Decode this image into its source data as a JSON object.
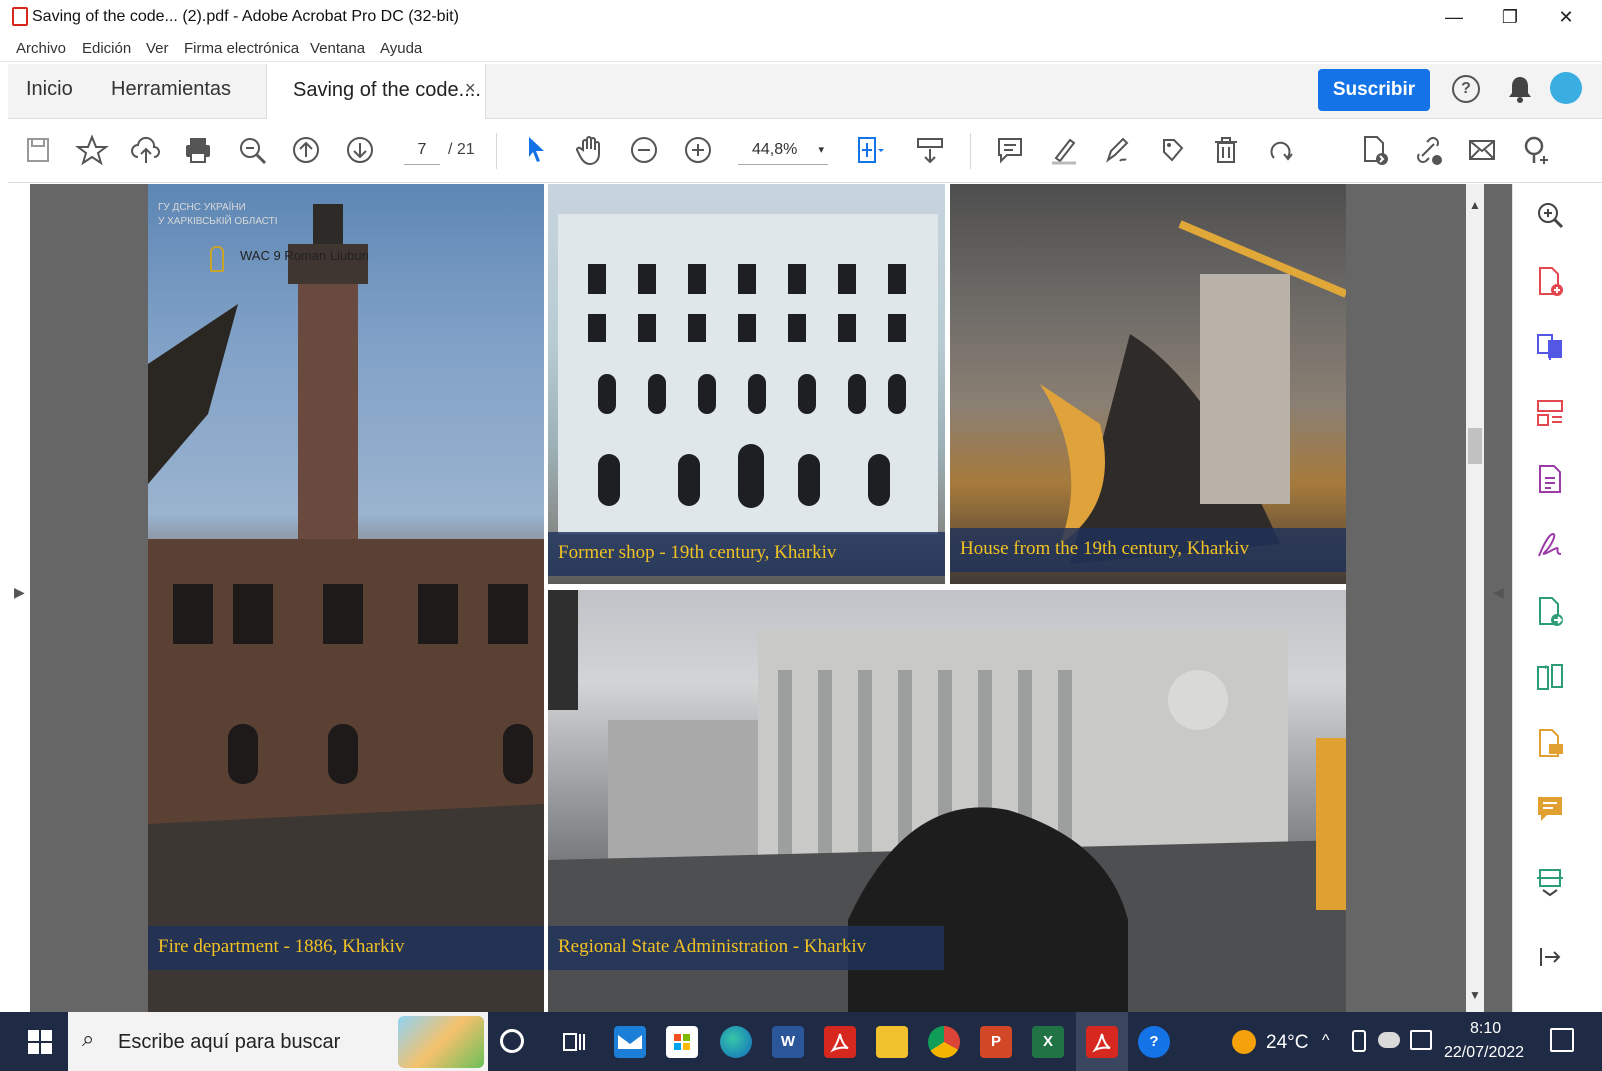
{
  "window": {
    "title": "Saving of the code... (2).pdf - Adobe Acrobat Pro DC (32-bit)",
    "controls": {
      "minimize": "—",
      "restore": "❐",
      "close": "✕"
    }
  },
  "menu": [
    "Archivo",
    "Edición",
    "Ver",
    "Firma electrónica",
    "Ventana",
    "Ayuda"
  ],
  "tabs": {
    "home": "Inicio",
    "tools": "Herramientas",
    "document": "Saving of the code....",
    "close_glyph": "×",
    "subscribe": "Suscribir",
    "help_glyph": "?"
  },
  "toolbar": {
    "page_current": "7",
    "page_total": "/ 21",
    "zoom": "44,8%",
    "zoom_caret": "▾"
  },
  "document": {
    "photos": [
      {
        "caption": "Fire department - 1886, Kharkiv",
        "watermark_line1": "ГУ ДСНС УКРАЇНИ",
        "watermark_line2": "У ХАРКІВСЬКІЙ ОБЛАСТІ",
        "credit": "WAC 9 Roman Liubun"
      },
      {
        "caption": "Former shop - 19th century, Kharkiv"
      },
      {
        "caption": "House from the 19th century, Kharkiv"
      },
      {
        "caption": "Regional State Administration - Kharkiv"
      }
    ]
  },
  "scrollbar": {
    "up": "▲",
    "down": "▼"
  },
  "side_arrows": {
    "left": "▶",
    "right": "◀"
  },
  "taskbar": {
    "search_placeholder": "Escribe aquí para buscar",
    "temperature": "24°C",
    "time": "8:10",
    "date": "22/07/2022",
    "apps": [
      "cortana",
      "task-view",
      "mail",
      "store",
      "edge",
      "word",
      "acrobat",
      "file-explorer",
      "chrome",
      "powerpoint",
      "excel",
      "acrobat-dc",
      "help"
    ],
    "app_letters": {
      "word": "W",
      "powerpoint": "P",
      "excel": "X"
    }
  },
  "colors": {
    "accent": "#1473e6",
    "caption_text": "#f2c224",
    "taskbar": "#1f2a44",
    "acrobat_red": "#d6281f"
  }
}
